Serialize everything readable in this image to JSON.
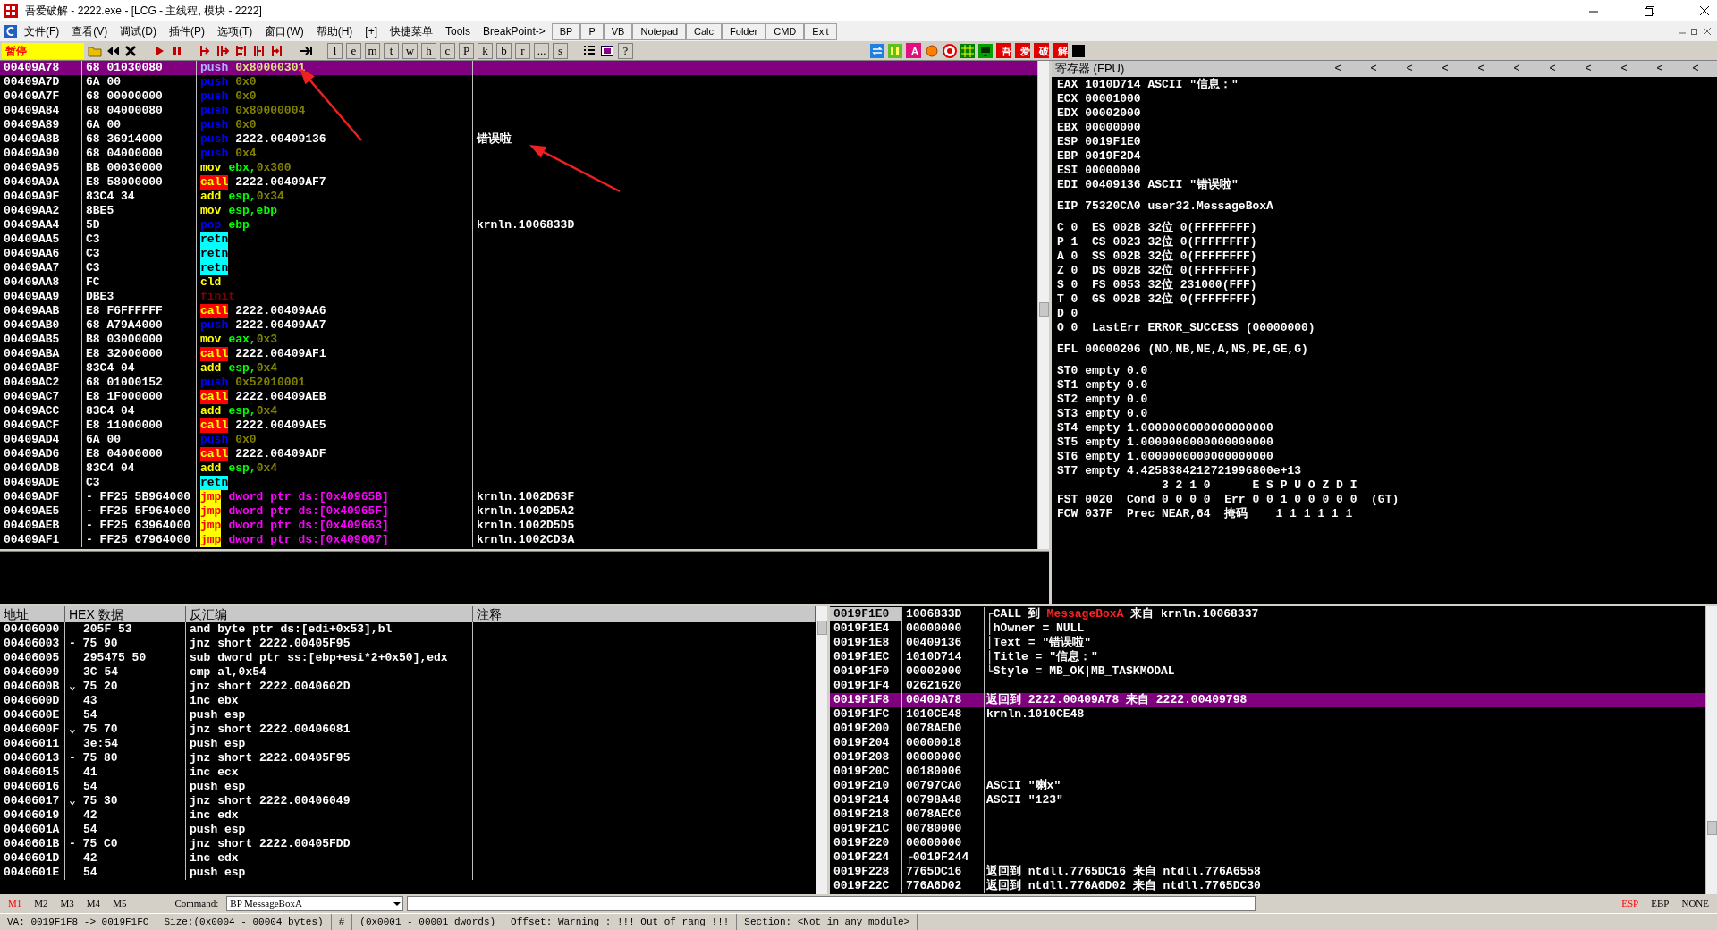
{
  "window": {
    "title": "吾爱破解 - 2222.exe - [LCG - 主线程, 模块 - 2222]"
  },
  "menu": [
    "文件(F)",
    "查看(V)",
    "调试(D)",
    "插件(P)",
    "选项(T)",
    "窗口(W)",
    "帮助(H)",
    "[+]",
    "快捷菜单",
    "Tools",
    "BreakPoint->"
  ],
  "shortcut_buttons": [
    "BP",
    "P",
    "VB",
    "Notepad",
    "Calc",
    "Folder",
    "CMD",
    "Exit"
  ],
  "toolbar": {
    "status": "暂停",
    "items": [
      {
        "kind": "open"
      },
      {
        "kind": "rewind"
      },
      {
        "kind": "close"
      },
      {
        "kind": "sep"
      },
      {
        "kind": "run"
      },
      {
        "kind": "pause"
      },
      {
        "kind": "sep"
      },
      {
        "kind": "step-in"
      },
      {
        "kind": "step-over"
      },
      {
        "kind": "trace-in"
      },
      {
        "kind": "trace-over"
      },
      {
        "kind": "till-return"
      },
      {
        "kind": "sep"
      },
      {
        "kind": "goto"
      },
      {
        "kind": "sep"
      },
      {
        "kind": "letter",
        "label": "l"
      },
      {
        "kind": "letter",
        "label": "e"
      },
      {
        "kind": "letter",
        "label": "m"
      },
      {
        "kind": "letter",
        "label": "t"
      },
      {
        "kind": "letter",
        "label": "w"
      },
      {
        "kind": "letter",
        "label": "h"
      },
      {
        "kind": "letter",
        "label": "c"
      },
      {
        "kind": "letter",
        "label": "P"
      },
      {
        "kind": "letter",
        "label": "k"
      },
      {
        "kind": "letter",
        "label": "b"
      },
      {
        "kind": "letter",
        "label": "r"
      },
      {
        "kind": "letter",
        "label": "..."
      },
      {
        "kind": "letter",
        "label": "s"
      },
      {
        "kind": "sep"
      },
      {
        "kind": "list"
      },
      {
        "kind": "windows"
      },
      {
        "kind": "letter",
        "label": "?"
      }
    ],
    "quick_items": [
      {
        "kind": "refresh"
      },
      {
        "kind": "bars"
      },
      {
        "kind": "label",
        "label": "A",
        "color": "#e0107f"
      },
      {
        "kind": "circle"
      },
      {
        "kind": "target"
      },
      {
        "kind": "grid"
      },
      {
        "kind": "monitor"
      },
      {
        "kind": "label",
        "label": "吾",
        "color": "#e00000"
      },
      {
        "kind": "label",
        "label": "爱",
        "color": "#e00000"
      },
      {
        "kind": "label",
        "label": "破",
        "color": "#e00000"
      },
      {
        "kind": "label",
        "label": "解",
        "color": "#e00000"
      },
      {
        "kind": "stop"
      }
    ]
  },
  "disasm": {
    "rows": [
      {
        "addr": "00409A78",
        "mark": "",
        "hex": "68 01030080",
        "mn": "push",
        "kind": "push",
        "ops": [
          {
            "text": "0x80000301",
            "kind": "imm"
          }
        ],
        "comment": "",
        "selected": true
      },
      {
        "addr": "00409A7D",
        "mark": "",
        "hex": "6A 00",
        "mn": "push",
        "kind": "push",
        "ops": [
          {
            "text": "0x0",
            "kind": "imm"
          }
        ],
        "comment": "",
        "selected": false
      },
      {
        "addr": "00409A7F",
        "mark": "",
        "hex": "68 00000000",
        "mn": "push",
        "kind": "push",
        "ops": [
          {
            "text": "0x0",
            "kind": "imm"
          }
        ],
        "comment": "",
        "selected": false
      },
      {
        "addr": "00409A84",
        "mark": "",
        "hex": "68 04000080",
        "mn": "push",
        "kind": "push",
        "ops": [
          {
            "text": "0x80000004",
            "kind": "imm"
          }
        ],
        "comment": "",
        "selected": false
      },
      {
        "addr": "00409A89",
        "mark": "",
        "hex": "6A 00",
        "mn": "push",
        "kind": "push",
        "ops": [
          {
            "text": "0x0",
            "kind": "imm"
          }
        ],
        "comment": "",
        "selected": false
      },
      {
        "addr": "00409A8B",
        "mark": "",
        "hex": "68 36914000",
        "mn": "push",
        "kind": "push",
        "ops": [
          {
            "text": "2222.00409136",
            "kind": "addr"
          }
        ],
        "comment": "错误啦",
        "selected": false
      },
      {
        "addr": "00409A90",
        "mark": "",
        "hex": "68 04000000",
        "mn": "push",
        "kind": "push",
        "ops": [
          {
            "text": "0x4",
            "kind": "imm"
          }
        ],
        "comment": "",
        "selected": false
      },
      {
        "addr": "00409A95",
        "mark": "",
        "hex": "BB 00030000",
        "mn": "mov",
        "kind": "plain",
        "ops": [
          {
            "text": "ebx,",
            "kind": "reg"
          },
          {
            "text": "0x300",
            "kind": "imm"
          }
        ],
        "comment": "",
        "selected": false
      },
      {
        "addr": "00409A9A",
        "mark": "",
        "hex": "E8 58000000",
        "mn": "call",
        "kind": "call",
        "ops": [
          {
            "text": "2222.00409AF7",
            "kind": "addr"
          }
        ],
        "comment": "",
        "selected": false
      },
      {
        "addr": "00409A9F",
        "mark": "",
        "hex": "83C4 34",
        "mn": "add",
        "kind": "plain",
        "ops": [
          {
            "text": "esp,",
            "kind": "reg"
          },
          {
            "text": "0x34",
            "kind": "imm"
          }
        ],
        "comment": "",
        "selected": false
      },
      {
        "addr": "00409AA2",
        "mark": "",
        "hex": "8BE5",
        "mn": "mov",
        "kind": "plain",
        "ops": [
          {
            "text": "esp,ebp",
            "kind": "reg"
          }
        ],
        "comment": "",
        "selected": false
      },
      {
        "addr": "00409AA4",
        "mark": "",
        "hex": "5D",
        "mn": "pop",
        "kind": "push",
        "ops": [
          {
            "text": "ebp",
            "kind": "reg"
          }
        ],
        "comment": "krnln.1006833D",
        "selected": false
      },
      {
        "addr": "00409AA5",
        "mark": "",
        "hex": "C3",
        "mn": "retn",
        "kind": "ret",
        "ops": [],
        "comment": "",
        "selected": false
      },
      {
        "addr": "00409AA6",
        "mark": "",
        "hex": "C3",
        "mn": "retn",
        "kind": "ret",
        "ops": [],
        "comment": "",
        "selected": false
      },
      {
        "addr": "00409AA7",
        "mark": "",
        "hex": "C3",
        "mn": "retn",
        "kind": "ret",
        "ops": [],
        "comment": "",
        "selected": false
      },
      {
        "addr": "00409AA8",
        "mark": "",
        "hex": "FC",
        "mn": "cld",
        "kind": "plain",
        "ops": [],
        "comment": "",
        "selected": false
      },
      {
        "addr": "00409AA9",
        "mark": "",
        "hex": "DBE3",
        "mn": "finit",
        "kind": "fpu",
        "ops": [],
        "comment": "",
        "selected": false
      },
      {
        "addr": "00409AAB",
        "mark": "",
        "hex": "E8 F6FFFFFF",
        "mn": "call",
        "kind": "call",
        "ops": [
          {
            "text": "2222.00409AA6",
            "kind": "addr"
          }
        ],
        "comment": "",
        "selected": false
      },
      {
        "addr": "00409AB0",
        "mark": "",
        "hex": "68 A79A4000",
        "mn": "push",
        "kind": "push",
        "ops": [
          {
            "text": "2222.00409AA7",
            "kind": "addr"
          }
        ],
        "comment": "",
        "selected": false
      },
      {
        "addr": "00409AB5",
        "mark": "",
        "hex": "B8 03000000",
        "mn": "mov",
        "kind": "plain",
        "ops": [
          {
            "text": "eax,",
            "kind": "reg"
          },
          {
            "text": "0x3",
            "kind": "imm"
          }
        ],
        "comment": "",
        "selected": false
      },
      {
        "addr": "00409ABA",
        "mark": "",
        "hex": "E8 32000000",
        "mn": "call",
        "kind": "call",
        "ops": [
          {
            "text": "2222.00409AF1",
            "kind": "addr"
          }
        ],
        "comment": "",
        "selected": false
      },
      {
        "addr": "00409ABF",
        "mark": "",
        "hex": "83C4 04",
        "mn": "add",
        "kind": "plain",
        "ops": [
          {
            "text": "esp,",
            "kind": "reg"
          },
          {
            "text": "0x4",
            "kind": "imm"
          }
        ],
        "comment": "",
        "selected": false
      },
      {
        "addr": "00409AC2",
        "mark": "",
        "hex": "68 01000152",
        "mn": "push",
        "kind": "push",
        "ops": [
          {
            "text": "0x52010001",
            "kind": "imm"
          }
        ],
        "comment": "",
        "selected": false
      },
      {
        "addr": "00409AC7",
        "mark": "",
        "hex": "E8 1F000000",
        "mn": "call",
        "kind": "call",
        "ops": [
          {
            "text": "2222.00409AEB",
            "kind": "addr"
          }
        ],
        "comment": "",
        "selected": false
      },
      {
        "addr": "00409ACC",
        "mark": "",
        "hex": "83C4 04",
        "mn": "add",
        "kind": "plain",
        "ops": [
          {
            "text": "esp,",
            "kind": "reg"
          },
          {
            "text": "0x4",
            "kind": "imm"
          }
        ],
        "comment": "",
        "selected": false
      },
      {
        "addr": "00409ACF",
        "mark": "",
        "hex": "E8 11000000",
        "mn": "call",
        "kind": "call",
        "ops": [
          {
            "text": "2222.00409AE5",
            "kind": "addr"
          }
        ],
        "comment": "",
        "selected": false
      },
      {
        "addr": "00409AD4",
        "mark": "",
        "hex": "6A 00",
        "mn": "push",
        "kind": "push",
        "ops": [
          {
            "text": "0x0",
            "kind": "imm"
          }
        ],
        "comment": "",
        "selected": false
      },
      {
        "addr": "00409AD6",
        "mark": "",
        "hex": "E8 04000000",
        "mn": "call",
        "kind": "call",
        "ops": [
          {
            "text": "2222.00409ADF",
            "kind": "addr"
          }
        ],
        "comment": "",
        "selected": false
      },
      {
        "addr": "00409ADB",
        "mark": "",
        "hex": "83C4 04",
        "mn": "add",
        "kind": "plain",
        "ops": [
          {
            "text": "esp,",
            "kind": "reg"
          },
          {
            "text": "0x4",
            "kind": "imm"
          }
        ],
        "comment": "",
        "selected": false
      },
      {
        "addr": "00409ADE",
        "mark": "",
        "hex": "C3",
        "mn": "retn",
        "kind": "ret",
        "ops": [],
        "comment": "",
        "selected": false
      },
      {
        "addr": "00409ADF",
        "mark": "-",
        "hex": "FF25 5B964000",
        "mn": "jmp",
        "kind": "jmp",
        "ops": [
          {
            "text": "dword ptr ds:[0x40965B]",
            "kind": "mem"
          }
        ],
        "comment": "krnln.1002D63F",
        "selected": false
      },
      {
        "addr": "00409AE5",
        "mark": "-",
        "hex": "FF25 5F964000",
        "mn": "jmp",
        "kind": "jmp",
        "ops": [
          {
            "text": "dword ptr ds:[0x40965F]",
            "kind": "mem"
          }
        ],
        "comment": "krnln.1002D5A2",
        "selected": false
      },
      {
        "addr": "00409AEB",
        "mark": "-",
        "hex": "FF25 63964000",
        "mn": "jmp",
        "kind": "jmp",
        "ops": [
          {
            "text": "dword ptr ds:[0x409663]",
            "kind": "mem"
          }
        ],
        "comment": "krnln.1002D5D5",
        "selected": false
      },
      {
        "addr": "00409AF1",
        "mark": "-",
        "hex": "FF25 67964000",
        "mn": "jmp",
        "kind": "jmp",
        "ops": [
          {
            "text": "dword ptr ds:[0x409667]",
            "kind": "mem"
          }
        ],
        "comment": "krnln.1002CD3A",
        "selected": false
      }
    ]
  },
  "registers": {
    "title": "寄存器 (FPU)",
    "arrows": [
      "<",
      "<",
      "<",
      "<",
      "<",
      "<",
      "<",
      "<",
      "<",
      "<",
      "<"
    ],
    "groups": [
      [
        "EAX 1010D714 ASCII \"信息：\"",
        "ECX 00001000",
        "EDX 00002000",
        "EBX 00000000",
        "ESP 0019F1E0",
        "EBP 0019F2D4",
        "ESI 00000000",
        "EDI 00409136 ASCII \"错误啦\""
      ],
      [
        "EIP 75320CA0 user32.MessageBoxA"
      ],
      [
        "C 0  ES 002B 32位 0(FFFFFFFF)",
        "P 1  CS 0023 32位 0(FFFFFFFF)",
        "A 0  SS 002B 32位 0(FFFFFFFF)",
        "Z 0  DS 002B 32位 0(FFFFFFFF)",
        "S 0  FS 0053 32位 231000(FFF)",
        "T 0  GS 002B 32位 0(FFFFFFFF)",
        "D 0",
        "O 0  LastErr ERROR_SUCCESS (00000000)"
      ],
      [
        "EFL 00000206 (NO,NB,NE,A,NS,PE,GE,G)"
      ],
      [
        "ST0 empty 0.0",
        "ST1 empty 0.0",
        "ST2 empty 0.0",
        "ST3 empty 0.0",
        "ST4 empty 1.0000000000000000000",
        "ST5 empty 1.0000000000000000000",
        "ST6 empty 1.0000000000000000000",
        "ST7 empty 4.4258384212721996800e+13",
        "               3 2 1 0      E S P U O Z D I",
        "FST 0020  Cond 0 0 0 0  Err 0 0 1 0 0 0 0 0  (GT)",
        "FCW 037F  Prec NEAR,64  掩码    1 1 1 1 1 1"
      ]
    ]
  },
  "dump": {
    "columns": [
      "地址",
      "HEX 数据",
      "反汇编",
      "注释"
    ],
    "rows": [
      {
        "addr": "00406000",
        "mark": "",
        "hex": "205F 53",
        "asm": "and byte ptr ds:[edi+0x53],bl"
      },
      {
        "addr": "00406003",
        "mark": "-",
        "hex": "75 90",
        "asm": "jnz short 2222.00405F95"
      },
      {
        "addr": "00406005",
        "mark": "",
        "hex": "295475 50",
        "asm": "sub dword ptr ss:[ebp+esi*2+0x50],edx"
      },
      {
        "addr": "00406009",
        "mark": "",
        "hex": "3C 54",
        "asm": "cmp al,0x54"
      },
      {
        "addr": "0040600B",
        "mark": "⌄",
        "hex": "75 20",
        "asm": "jnz short 2222.0040602D"
      },
      {
        "addr": "0040600D",
        "mark": "",
        "hex": "43",
        "asm": "inc ebx"
      },
      {
        "addr": "0040600E",
        "mark": "",
        "hex": "54",
        "asm": "push esp"
      },
      {
        "addr": "0040600F",
        "mark": "⌄",
        "hex": "75 70",
        "asm": "jnz short 2222.00406081"
      },
      {
        "addr": "00406011",
        "mark": "",
        "hex": "3e:54",
        "asm": "push esp"
      },
      {
        "addr": "00406013",
        "mark": "-",
        "hex": "75 80",
        "asm": "jnz short 2222.00405F95"
      },
      {
        "addr": "00406015",
        "mark": "",
        "hex": "41",
        "asm": "inc ecx"
      },
      {
        "addr": "00406016",
        "mark": "",
        "hex": "54",
        "asm": "push esp"
      },
      {
        "addr": "00406017",
        "mark": "⌄",
        "hex": "75 30",
        "asm": "jnz short 2222.00406049"
      },
      {
        "addr": "00406019",
        "mark": "",
        "hex": "42",
        "asm": "inc edx"
      },
      {
        "addr": "0040601A",
        "mark": "",
        "hex": "54",
        "asm": "push esp"
      },
      {
        "addr": "0040601B",
        "mark": "-",
        "hex": "75 C0",
        "asm": "jnz short 2222.00405FDD"
      },
      {
        "addr": "0040601D",
        "mark": "",
        "hex": "42",
        "asm": "inc edx"
      },
      {
        "addr": "0040601E",
        "mark": "",
        "hex": "54",
        "asm": "push esp"
      }
    ]
  },
  "stack": {
    "rows": [
      {
        "addr": "0019F1E0",
        "value": "1006833D",
        "esp": true,
        "selected": false,
        "comment": [
          {
            "text": "┌CALL 到 ",
            "kind": "text"
          },
          {
            "text": "MessageBoxA",
            "kind": "api"
          },
          {
            "text": " 来自 krnln.10068337",
            "kind": "text"
          }
        ]
      },
      {
        "addr": "0019F1E4",
        "value": "00000000",
        "esp": false,
        "selected": false,
        "comment": [
          {
            "text": "│hOwner = NULL",
            "kind": "text"
          }
        ]
      },
      {
        "addr": "0019F1E8",
        "value": "00409136",
        "esp": false,
        "selected": false,
        "comment": [
          {
            "text": "│Text = \"错误啦\"",
            "kind": "text"
          }
        ]
      },
      {
        "addr": "0019F1EC",
        "value": "1010D714",
        "esp": false,
        "selected": false,
        "comment": [
          {
            "text": "│Title = \"信息：\"",
            "kind": "text"
          }
        ]
      },
      {
        "addr": "0019F1F0",
        "value": "00002000",
        "esp": false,
        "selected": false,
        "comment": [
          {
            "text": "└Style = MB_OK|MB_TASKMODAL",
            "kind": "text"
          }
        ]
      },
      {
        "addr": "0019F1F4",
        "value": "02621620",
        "esp": false,
        "selected": false,
        "comment": []
      },
      {
        "addr": "0019F1F8",
        "value": "00409A78",
        "esp": false,
        "selected": true,
        "comment": [
          {
            "text": "返回到 2222.00409A78 来自 2222.00409798",
            "kind": "text"
          }
        ]
      },
      {
        "addr": "0019F1FC",
        "value": "1010CE48",
        "esp": false,
        "selected": false,
        "comment": [
          {
            "text": "krnln.1010CE48",
            "kind": "text"
          }
        ]
      },
      {
        "addr": "0019F200",
        "value": "0078AED0",
        "esp": false,
        "selected": false,
        "comment": []
      },
      {
        "addr": "0019F204",
        "value": "00000018",
        "esp": false,
        "selected": false,
        "comment": []
      },
      {
        "addr": "0019F208",
        "value": "00000000",
        "esp": false,
        "selected": false,
        "comment": []
      },
      {
        "addr": "0019F20C",
        "value": "00180006",
        "esp": false,
        "selected": false,
        "comment": []
      },
      {
        "addr": "0019F210",
        "value": "00797CA0",
        "esp": false,
        "selected": false,
        "comment": [
          {
            "text": "ASCII \"喇x\"",
            "kind": "text"
          }
        ]
      },
      {
        "addr": "0019F214",
        "value": "00798A48",
        "esp": false,
        "selected": false,
        "comment": [
          {
            "text": "ASCII \"123\"",
            "kind": "text"
          }
        ]
      },
      {
        "addr": "0019F218",
        "value": "0078AEC0",
        "esp": false,
        "selected": false,
        "comment": []
      },
      {
        "addr": "0019F21C",
        "value": "00780000",
        "esp": false,
        "selected": false,
        "comment": []
      },
      {
        "addr": "0019F220",
        "value": "00000000",
        "esp": false,
        "selected": false,
        "comment": []
      },
      {
        "addr": "0019F224",
        "value": "┌0019F244",
        "esp": false,
        "selected": false,
        "comment": []
      },
      {
        "addr": "0019F228",
        "value": "7765DC16",
        "esp": false,
        "selected": false,
        "comment": [
          {
            "text": "返回到 ntdll.7765DC16 来自 ntdll.776A6558",
            "kind": "text"
          }
        ]
      },
      {
        "addr": "0019F22C",
        "value": "776A6D02",
        "esp": false,
        "selected": false,
        "comment": [
          {
            "text": "返回到 ntdll.776A6D02 来自 ntdll.7765DC30",
            "kind": "text"
          }
        ]
      }
    ]
  },
  "command_bar": {
    "memory_tabs": [
      {
        "label": "M1",
        "selected": true
      },
      {
        "label": "M2",
        "selected": false
      },
      {
        "label": "M3",
        "selected": false
      },
      {
        "label": "M4",
        "selected": false
      },
      {
        "label": "M5",
        "selected": false
      }
    ],
    "label": "Command:",
    "value": "BP MessageBoxA",
    "stack_modes": [
      {
        "label": "ESP",
        "selected": true
      },
      {
        "label": "EBP",
        "selected": false
      },
      {
        "label": "NONE",
        "selected": false
      }
    ]
  },
  "status_bar": [
    "VA: 0019F1F8 -> 0019F1FC",
    "Size:(0x0004 - 00004 bytes)",
    "#",
    "(0x0001 - 00001 dwords)",
    "Offset: Warning : !!! Out of rang !!!",
    "Section: <Not in any module>"
  ]
}
